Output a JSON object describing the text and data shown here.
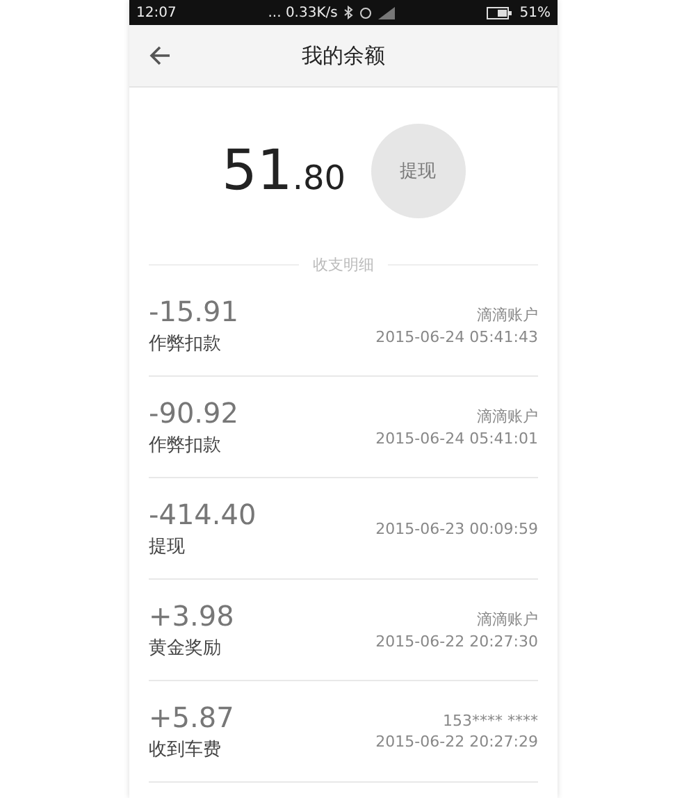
{
  "status_bar": {
    "time": "12:07",
    "network_speed": "... 0.33K/s",
    "battery": "51%"
  },
  "app_bar": {
    "title": "我的余额"
  },
  "balance": {
    "integer": "51",
    "decimal": ".80"
  },
  "withdraw_button": {
    "label": "提现",
    "disabled": true
  },
  "section_title": "收支明细",
  "transactions": [
    {
      "amount": "-15.91",
      "type": "作弊扣款",
      "account": "滴滴账户",
      "time": "2015-06-24 05:41:43"
    },
    {
      "amount": "-90.92",
      "type": "作弊扣款",
      "account": "滴滴账户",
      "time": "2015-06-24 05:41:01"
    },
    {
      "amount": "-414.40",
      "type": "提现",
      "time": "2015-06-23 00:09:59"
    },
    {
      "amount": "+3.98",
      "type": "黄金奖励",
      "account": "滴滴账户",
      "time": "2015-06-22 20:27:30"
    },
    {
      "amount": "+5.87",
      "type": "收到车费",
      "account": "153****    ****",
      "time": "2015-06-22 20:27:29"
    }
  ]
}
